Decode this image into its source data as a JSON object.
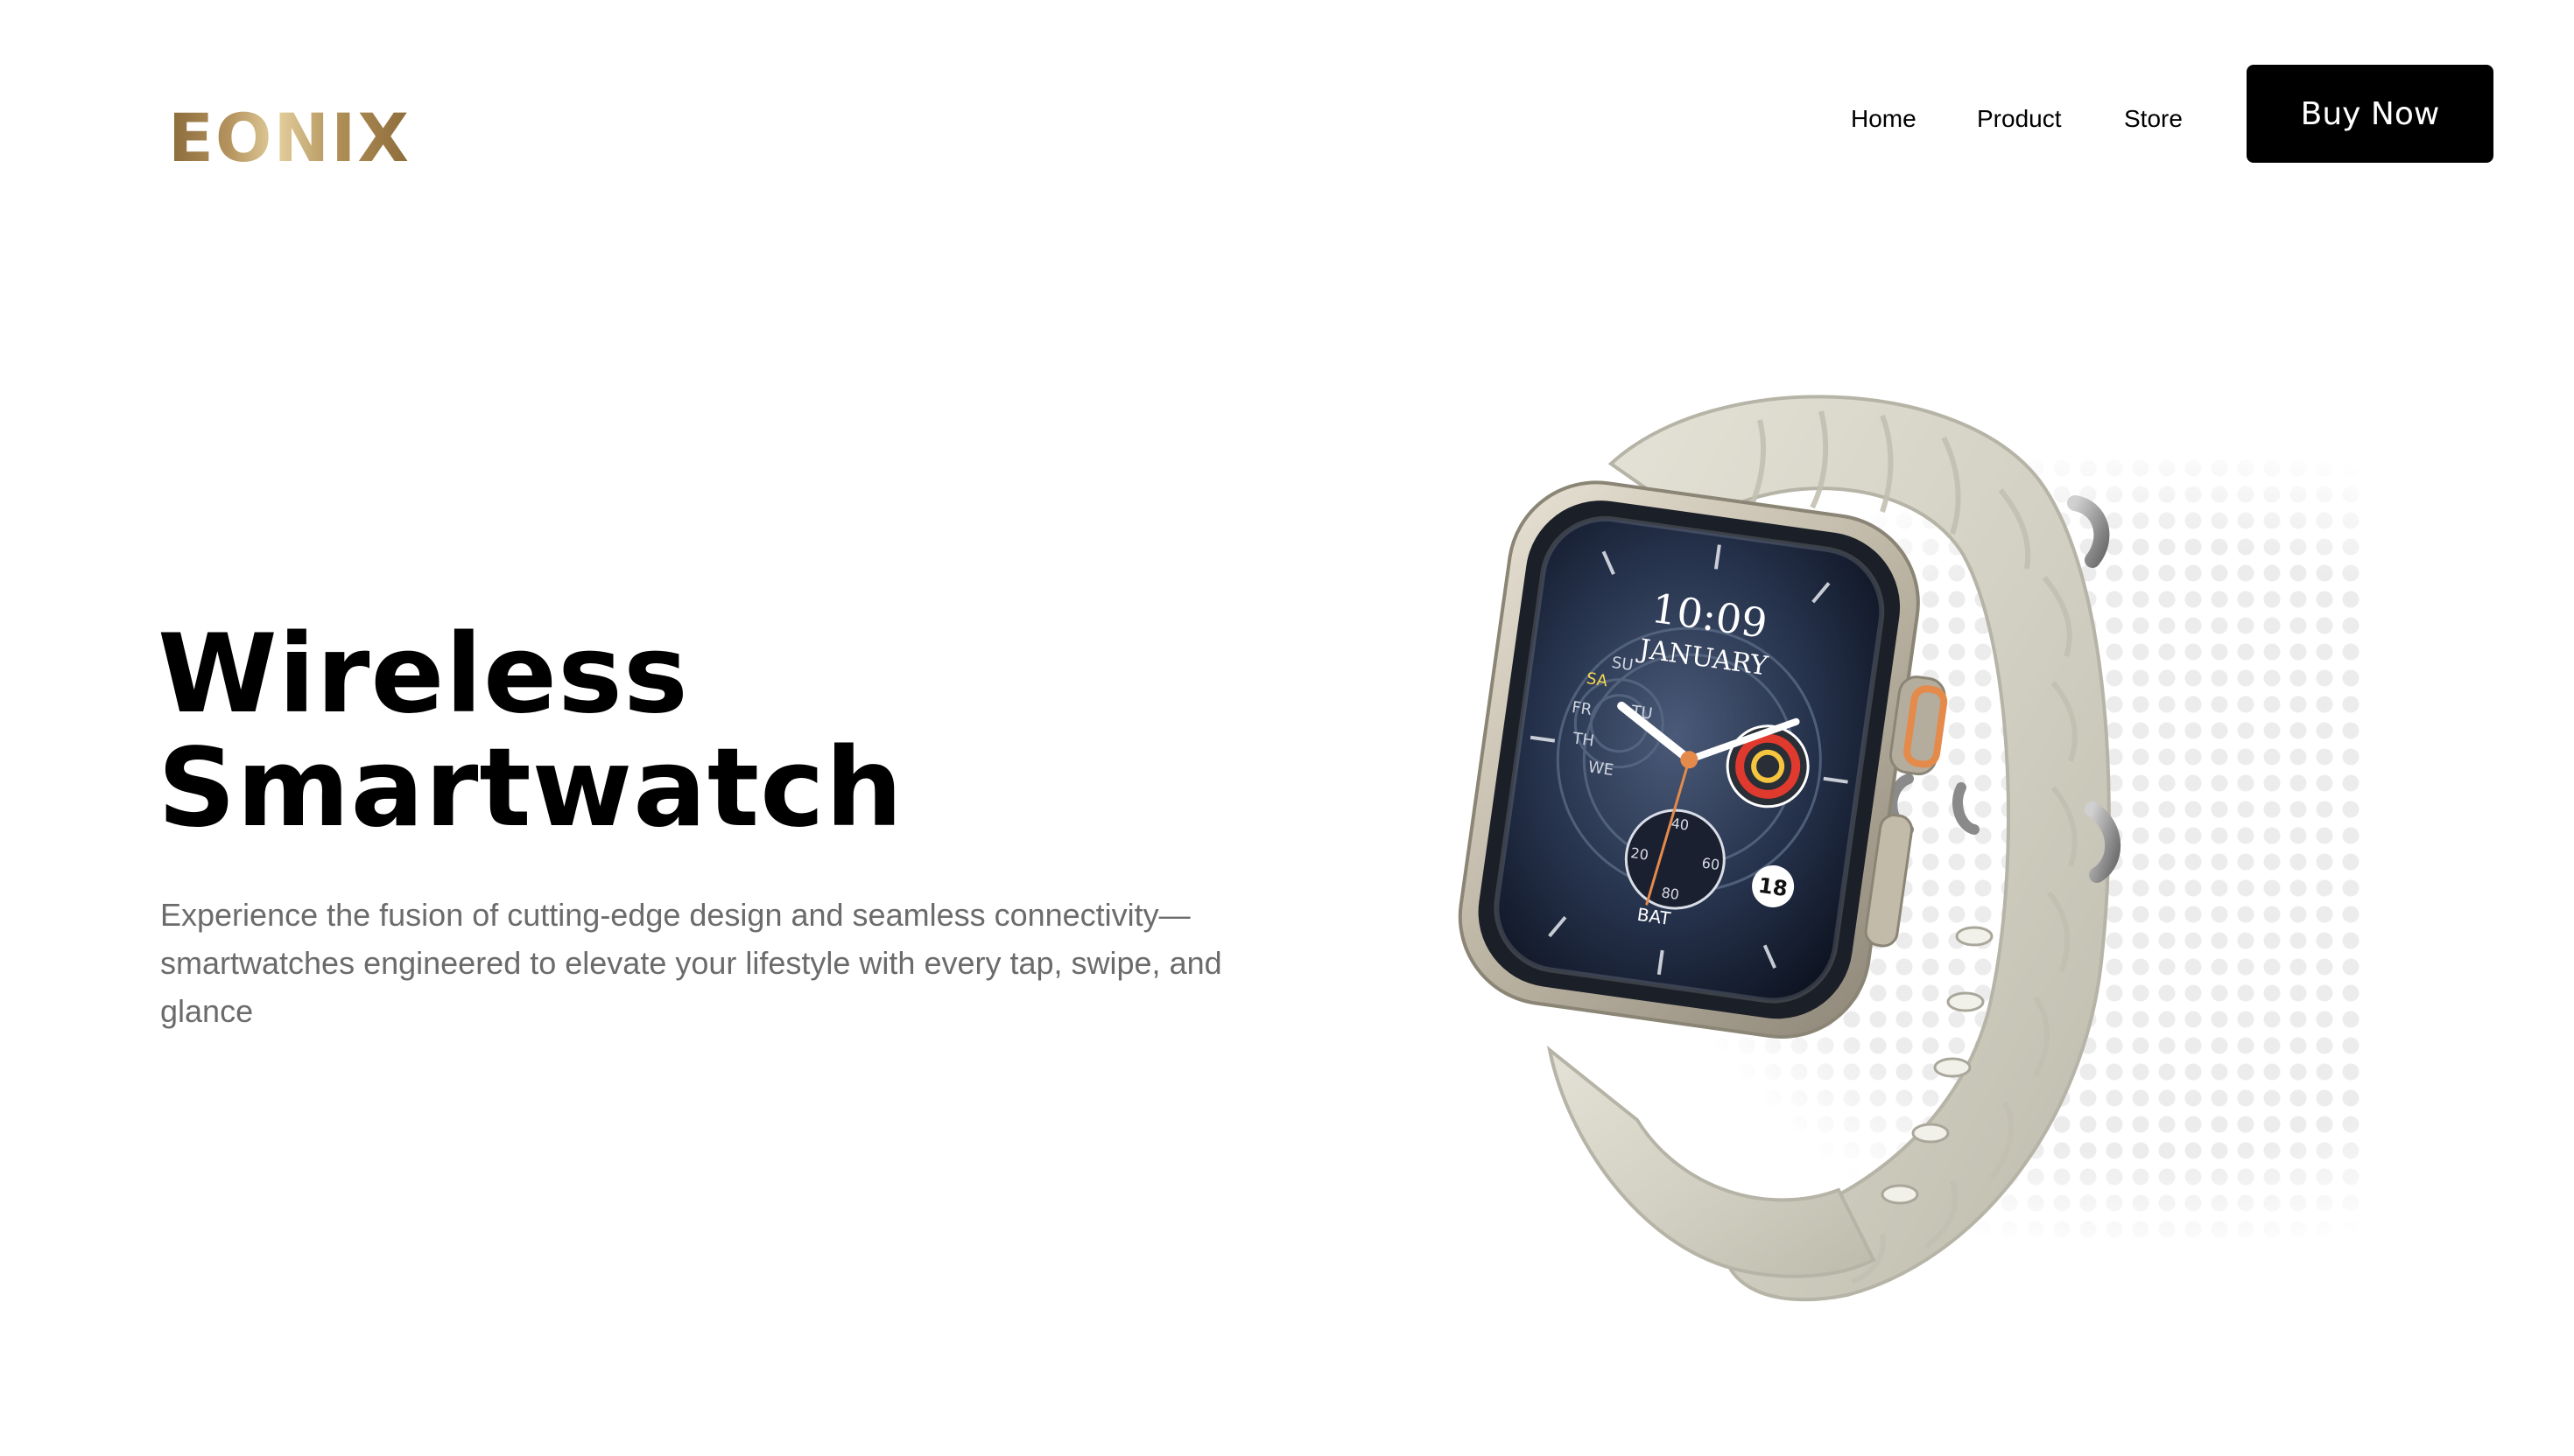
{
  "header": {
    "logo": "EONIX",
    "nav": {
      "home": "Home",
      "product": "Product",
      "store": "Store"
    },
    "cta": "Buy Now"
  },
  "hero": {
    "title_line1": "Wireless",
    "title_line2": "Smartwatch",
    "description": "Experience the fusion of cutting-edge design and seamless connectivity—smartwatches engineered to elevate your lifestyle with every tap, swipe, and glance"
  },
  "product": {
    "image": "smartwatch-product-image",
    "watch_face": {
      "time": "10:09",
      "month": "JANUARY",
      "date": "18",
      "weekdays": [
        "SU",
        "SA",
        "FR",
        "TH",
        "WE",
        "TU"
      ],
      "battery_label": "BAT",
      "subdial_numbers": [
        "20",
        "40",
        "60",
        "80"
      ]
    }
  },
  "colors": {
    "logo_gold": "#b08f57",
    "button_bg": "#000000",
    "button_text": "#ffffff",
    "title": "#000000",
    "description": "#6b6b6b",
    "band": "#d9d7c9",
    "case": "#c9c2b2",
    "crown_accent": "#e48a4b"
  }
}
